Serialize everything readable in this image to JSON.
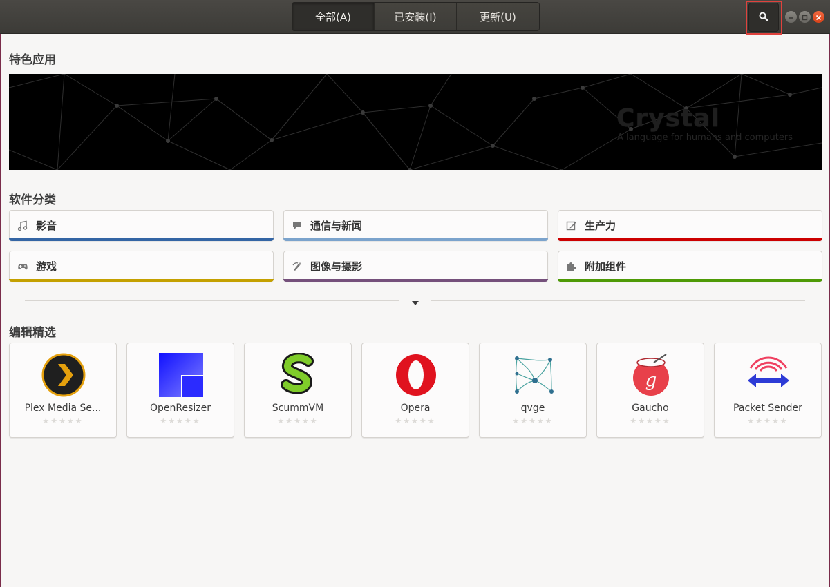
{
  "header": {
    "tabs": [
      {
        "label": "全部(A)",
        "active": true
      },
      {
        "label": "已安装(I)",
        "active": false
      },
      {
        "label": "更新(U)",
        "active": false
      }
    ],
    "search_icon": "search-icon",
    "window_controls": [
      "minimize-icon",
      "maximize-icon",
      "close-icon"
    ]
  },
  "featured": {
    "title": "特色应用",
    "banner": {
      "app_title": "Crystal",
      "subtitle": "A language for humans and computers"
    }
  },
  "categories": {
    "title": "软件分类",
    "items": [
      {
        "label": "影音",
        "icon": "music-note-icon",
        "color": "#3465a4"
      },
      {
        "label": "通信与新闻",
        "icon": "chat-bubble-icon",
        "color": "#7ba3cc"
      },
      {
        "label": "生产力",
        "icon": "edit-icon",
        "color": "#cc0000"
      },
      {
        "label": "游戏",
        "icon": "gamepad-icon",
        "color": "#c4a000"
      },
      {
        "label": "图像与摄影",
        "icon": "palette-icon",
        "color": "#75507b"
      },
      {
        "label": "附加组件",
        "icon": "puzzle-icon",
        "color": "#4e9a06"
      }
    ]
  },
  "editors_picks": {
    "title": "编辑精选",
    "apps": [
      {
        "name": "Plex Media Se...",
        "icon": "plex-icon",
        "rating": 0
      },
      {
        "name": "OpenResizer",
        "icon": "openresizer-icon",
        "rating": 0
      },
      {
        "name": "ScummVM",
        "icon": "scummvm-icon",
        "rating": 0
      },
      {
        "name": "Opera",
        "icon": "opera-icon",
        "rating": 0
      },
      {
        "name": "qvge",
        "icon": "qvge-icon",
        "rating": 0
      },
      {
        "name": "Gaucho",
        "icon": "gaucho-icon",
        "rating": 0
      },
      {
        "name": "Packet Sender",
        "icon": "packet-sender-icon",
        "rating": 0
      }
    ],
    "stars_text": "★★★★★"
  }
}
